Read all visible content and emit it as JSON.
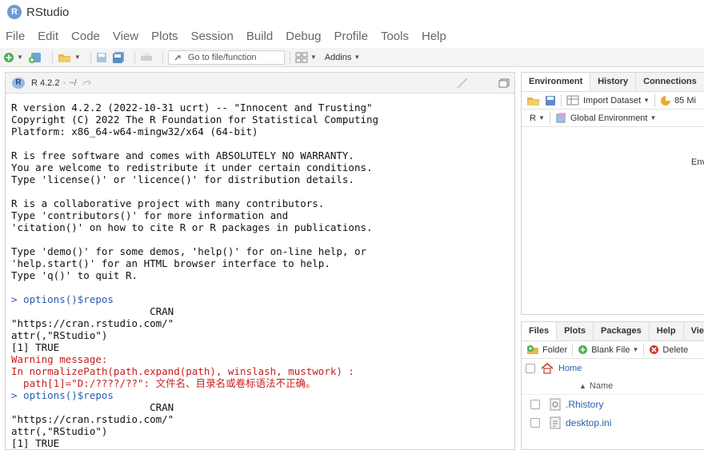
{
  "window": {
    "title": "RStudio",
    "logo_letter": "R"
  },
  "menu": [
    "File",
    "Edit",
    "Code",
    "View",
    "Plots",
    "Session",
    "Build",
    "Debug",
    "Profile",
    "Tools",
    "Help"
  ],
  "toolbar": {
    "goto_placeholder": "Go to file/function",
    "addins_label": "Addins"
  },
  "console": {
    "r_version": "R 4.2.2",
    "path": "~/",
    "lines": [
      {
        "t": "R version 4.2.2 (2022-10-31 ucrt) -- \"Innocent and Trusting\"",
        "k": "out"
      },
      {
        "t": "Copyright (C) 2022 The R Foundation for Statistical Computing",
        "k": "out"
      },
      {
        "t": "Platform: x86_64-w64-mingw32/x64 (64-bit)",
        "k": "out"
      },
      {
        "t": "",
        "k": "gap"
      },
      {
        "t": "R is free software and comes with ABSOLUTELY NO WARRANTY.",
        "k": "out"
      },
      {
        "t": "You are welcome to redistribute it under certain conditions.",
        "k": "out"
      },
      {
        "t": "Type 'license()' or 'licence()' for distribution details.",
        "k": "out"
      },
      {
        "t": "",
        "k": "gap"
      },
      {
        "t": "R is a collaborative project with many contributors.",
        "k": "out"
      },
      {
        "t": "Type 'contributors()' for more information and",
        "k": "out"
      },
      {
        "t": "'citation()' on how to cite R or R packages in publications.",
        "k": "out"
      },
      {
        "t": "",
        "k": "gap"
      },
      {
        "t": "Type 'demo()' for some demos, 'help()' for on-line help, or",
        "k": "out"
      },
      {
        "t": "'help.start()' for an HTML browser interface to help.",
        "k": "out"
      },
      {
        "t": "Type 'q()' to quit R.",
        "k": "out"
      },
      {
        "t": "",
        "k": "gap"
      },
      {
        "t": "> options()$repos",
        "k": "cmd"
      },
      {
        "t": "                       CRAN",
        "k": "out"
      },
      {
        "t": "\"https://cran.rstudio.com/\"",
        "k": "out"
      },
      {
        "t": "attr(,\"RStudio\")",
        "k": "out"
      },
      {
        "t": "[1] TRUE",
        "k": "out"
      },
      {
        "t": "Warning message:",
        "k": "err"
      },
      {
        "t": "In normalizePath(path.expand(path), winslash, mustwork) :",
        "k": "err"
      },
      {
        "t": "  path[1]=\"D:/????/??\": 文件名、目录名或卷标语法不正确。",
        "k": "err"
      },
      {
        "t": "> options()$repos",
        "k": "cmd"
      },
      {
        "t": "                       CRAN",
        "k": "out"
      },
      {
        "t": "\"https://cran.rstudio.com/\"",
        "k": "out"
      },
      {
        "t": "attr(,\"RStudio\")",
        "k": "out"
      },
      {
        "t": "[1] TRUE",
        "k": "out"
      }
    ]
  },
  "env_pane": {
    "tabs": [
      "Environment",
      "History",
      "Connections"
    ],
    "import_label": "Import Dataset",
    "memory_label": "85 Mi",
    "lang_label": "R",
    "scope_label": "Global Environment",
    "empty_text": "Env"
  },
  "files_pane": {
    "tabs": [
      "Files",
      "Plots",
      "Packages",
      "Help",
      "Viev"
    ],
    "folder_label": "Folder",
    "blank_file_label": "Blank File",
    "delete_label": "Delete",
    "breadcrumb": "Home",
    "name_col": "Name",
    "files": [
      ".Rhistory",
      "desktop.ini"
    ]
  }
}
